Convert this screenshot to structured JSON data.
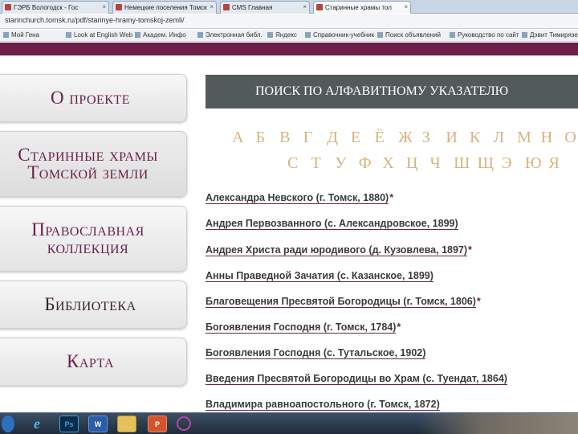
{
  "browser": {
    "tabs": [
      {
        "label": "ГЭРБ Вологодск - Гос",
        "active": false
      },
      {
        "label": "Немецкие поселения Томск",
        "active": false
      },
      {
        "label": "CMS Главная",
        "active": false
      },
      {
        "label": "Старинные храмы тол",
        "active": true
      }
    ],
    "url": "starinchurch.tomsk.ru/pdf/starinye-hramy-tomskoj-zemli/",
    "bookmarks": [
      "Мой Гена",
      "Look at English Web",
      "Академ. Инфо",
      "Электронная библ.",
      "Яндекс",
      "Справочник-учебник",
      "Поиск объявлений",
      "Руководство по сайт",
      "Дэвит Тимирязев"
    ]
  },
  "menu": [
    {
      "label_line1": "О проекте",
      "label_line2": ""
    },
    {
      "label_line1": "Старинные храмы",
      "label_line2": "Томской земли"
    },
    {
      "label_line1": "Православная",
      "label_line2": "коллекция"
    },
    {
      "label_line1": "Библиотека",
      "label_line2": ""
    },
    {
      "label_line1": "Карта",
      "label_line2": ""
    }
  ],
  "search": {
    "title": "ПОИСК ПО АЛФАВИТНОМУ УКАЗАТЕЛЮ",
    "alphabet_row1": [
      "А",
      "Б",
      "В",
      "Г",
      "Д",
      "Е",
      "Ё",
      "Ж",
      "З",
      "И",
      "К",
      "Л",
      "М",
      "Н",
      "О"
    ],
    "alphabet_row2": [
      "С",
      "Т",
      "У",
      "Ф",
      "Х",
      "Ц",
      "Ч",
      "Ш",
      "Щ",
      "Э",
      "Ю",
      "Я"
    ]
  },
  "entries": [
    {
      "text": "Александра Невского (г. Томск, 1880)",
      "star": "*"
    },
    {
      "text": "Андрея Первозванного (с. Александровское, 1899)",
      "star": ""
    },
    {
      "text": "Андрея Христа ради юродивого (д. Кузовлева, 1897)",
      "star": "*"
    },
    {
      "text": "Анны Праведной Зачатия (с. Казанское, 1899)",
      "star": ""
    },
    {
      "text": "Благовещения Пресвятой Богородицы (г. Томск, 1806)",
      "star": "*"
    },
    {
      "text": "Богоявления Господня (г. Томск, 1784)",
      "star": "*"
    },
    {
      "text": "Богоявления Господня (с. Тутальское, 1902)",
      "star": ""
    },
    {
      "text": "Введения Пресвятой Богородицы во Храм (с. Туендат, 1864)",
      "star": ""
    },
    {
      "text": "Владимира равноапостольного (г. Томск, 1872)",
      "star": ""
    }
  ],
  "taskbar": {
    "items": [
      "start-icon",
      "ie-icon",
      "photoshop-icon",
      "word-icon",
      "folder-icon",
      "powerpoint-icon",
      "app-icon"
    ],
    "ps_label": "Ps",
    "w_label": "W",
    "p_label": "P"
  },
  "colors": {
    "brand": "#6b1f4a",
    "letters": "#d7b37f",
    "header_bg": "#535a5a"
  }
}
